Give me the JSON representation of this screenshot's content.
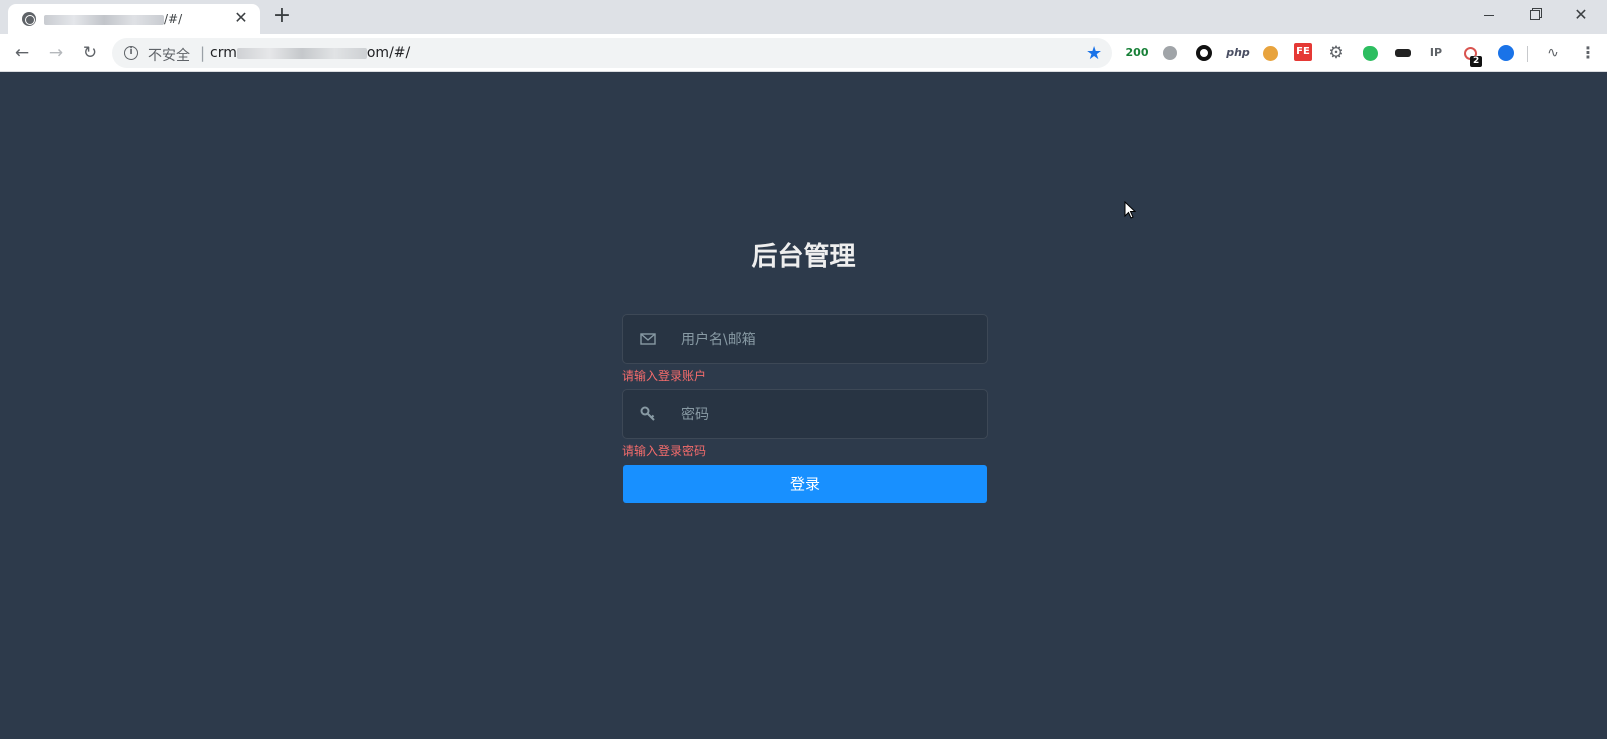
{
  "browser": {
    "tab_title": "/#/",
    "new_tab_symbol": "+",
    "omnibox": {
      "security_label": "不安全",
      "url_prefix": "crm",
      "url_suffix": "om/#/"
    },
    "extensions": {
      "status_code": "200",
      "php_label": "php",
      "fe_label": "FE",
      "ip_label": "IP",
      "badge_count": "2"
    }
  },
  "login": {
    "title": "后台管理",
    "username_placeholder": "用户名\\邮箱",
    "username_error": "请输入登录账户",
    "password_placeholder": "密码",
    "password_error": "请输入登录密码",
    "submit_label": "登录"
  },
  "colors": {
    "page_background": "#2d3a4b",
    "input_background": "#283443",
    "primary_button": "#1890ff",
    "error_text": "#f56c6c",
    "bookmark_star": "#1a73e8"
  }
}
